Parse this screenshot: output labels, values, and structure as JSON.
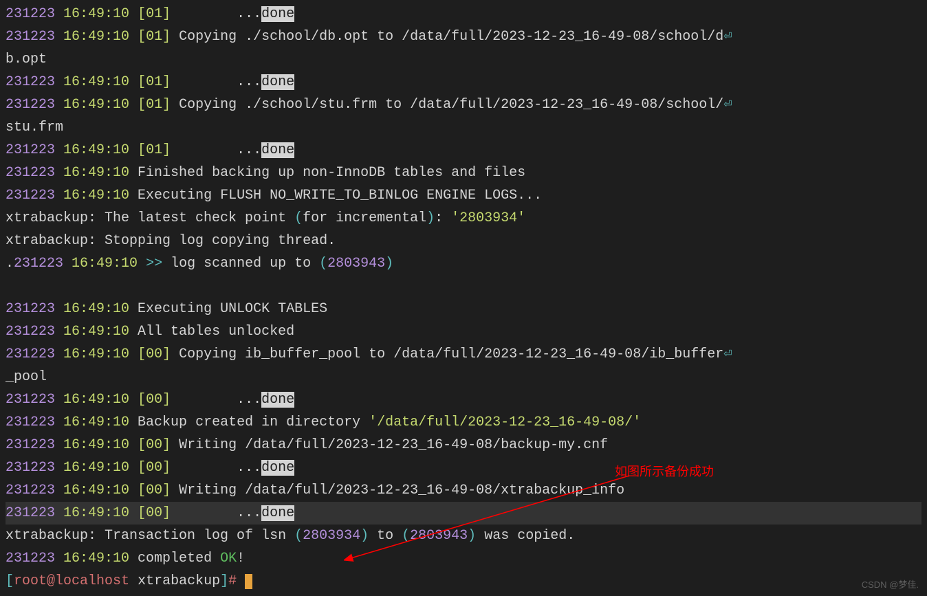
{
  "lines": [
    {
      "segments": [
        {
          "c": "ts-date",
          "t": "231223"
        },
        {
          "c": "txt",
          "t": " "
        },
        {
          "c": "ts-time",
          "t": "16:49:10"
        },
        {
          "c": "txt",
          "t": " "
        },
        {
          "c": "tag",
          "t": "[01]"
        },
        {
          "c": "txt",
          "t": "        ..."
        },
        {
          "c": "hl",
          "t": "done"
        }
      ]
    },
    {
      "segments": [
        {
          "c": "ts-date",
          "t": "231223"
        },
        {
          "c": "txt",
          "t": " "
        },
        {
          "c": "ts-time",
          "t": "16:49:10"
        },
        {
          "c": "txt",
          "t": " "
        },
        {
          "c": "tag",
          "t": "[01]"
        },
        {
          "c": "txt",
          "t": " Copying ./school/db.opt to /data/full/2023-12-23_16-49-08/school/d"
        },
        {
          "c": "wrap-icon",
          "t": "⏎"
        }
      ]
    },
    {
      "segments": [
        {
          "c": "txt",
          "t": "b.opt"
        }
      ]
    },
    {
      "segments": [
        {
          "c": "ts-date",
          "t": "231223"
        },
        {
          "c": "txt",
          "t": " "
        },
        {
          "c": "ts-time",
          "t": "16:49:10"
        },
        {
          "c": "txt",
          "t": " "
        },
        {
          "c": "tag",
          "t": "[01]"
        },
        {
          "c": "txt",
          "t": "        ..."
        },
        {
          "c": "hl",
          "t": "done"
        }
      ]
    },
    {
      "segments": [
        {
          "c": "ts-date",
          "t": "231223"
        },
        {
          "c": "txt",
          "t": " "
        },
        {
          "c": "ts-time",
          "t": "16:49:10"
        },
        {
          "c": "txt",
          "t": " "
        },
        {
          "c": "tag",
          "t": "[01]"
        },
        {
          "c": "txt",
          "t": " Copying ./school/stu.frm to /data/full/2023-12-23_16-49-08/school/"
        },
        {
          "c": "wrap-icon",
          "t": "⏎"
        }
      ]
    },
    {
      "segments": [
        {
          "c": "txt",
          "t": "stu.frm"
        }
      ]
    },
    {
      "segments": [
        {
          "c": "ts-date",
          "t": "231223"
        },
        {
          "c": "txt",
          "t": " "
        },
        {
          "c": "ts-time",
          "t": "16:49:10"
        },
        {
          "c": "txt",
          "t": " "
        },
        {
          "c": "tag",
          "t": "[01]"
        },
        {
          "c": "txt",
          "t": "        ..."
        },
        {
          "c": "hl",
          "t": "done"
        }
      ]
    },
    {
      "segments": [
        {
          "c": "ts-date",
          "t": "231223"
        },
        {
          "c": "txt",
          "t": " "
        },
        {
          "c": "ts-time",
          "t": "16:49:10"
        },
        {
          "c": "txt",
          "t": " Finished backing up non-InnoDB tables and files"
        }
      ]
    },
    {
      "segments": [
        {
          "c": "ts-date",
          "t": "231223"
        },
        {
          "c": "txt",
          "t": " "
        },
        {
          "c": "ts-time",
          "t": "16:49:10"
        },
        {
          "c": "txt",
          "t": " Executing FLUSH NO_WRITE_TO_BINLOG ENGINE LOGS..."
        }
      ]
    },
    {
      "segments": [
        {
          "c": "txt",
          "t": "xtrabackup: The latest check point "
        },
        {
          "c": "cyan",
          "t": "("
        },
        {
          "c": "txt",
          "t": "for incremental"
        },
        {
          "c": "cyan",
          "t": ")"
        },
        {
          "c": "txt",
          "t": ": "
        },
        {
          "c": "yellow",
          "t": "'2803934'"
        }
      ]
    },
    {
      "segments": [
        {
          "c": "txt",
          "t": "xtrabackup: Stopping log copying thread."
        }
      ]
    },
    {
      "segments": [
        {
          "c": "txt",
          "t": "."
        },
        {
          "c": "ts-date",
          "t": "231223"
        },
        {
          "c": "txt",
          "t": " "
        },
        {
          "c": "ts-time",
          "t": "16:49:10"
        },
        {
          "c": "txt",
          "t": " "
        },
        {
          "c": "cyan",
          "t": ">>"
        },
        {
          "c": "txt",
          "t": " log scanned up to "
        },
        {
          "c": "cyan",
          "t": "("
        },
        {
          "c": "ts-date",
          "t": "2803943"
        },
        {
          "c": "cyan",
          "t": ")"
        }
      ]
    },
    {
      "segments": [
        {
          "c": "txt",
          "t": " "
        }
      ]
    },
    {
      "segments": [
        {
          "c": "ts-date",
          "t": "231223"
        },
        {
          "c": "txt",
          "t": " "
        },
        {
          "c": "ts-time",
          "t": "16:49:10"
        },
        {
          "c": "txt",
          "t": " Executing UNLOCK TABLES"
        }
      ]
    },
    {
      "segments": [
        {
          "c": "ts-date",
          "t": "231223"
        },
        {
          "c": "txt",
          "t": " "
        },
        {
          "c": "ts-time",
          "t": "16:49:10"
        },
        {
          "c": "txt",
          "t": " All tables unlocked"
        }
      ]
    },
    {
      "segments": [
        {
          "c": "ts-date",
          "t": "231223"
        },
        {
          "c": "txt",
          "t": " "
        },
        {
          "c": "ts-time",
          "t": "16:49:10"
        },
        {
          "c": "txt",
          "t": " "
        },
        {
          "c": "tag",
          "t": "[00]"
        },
        {
          "c": "txt",
          "t": " Copying ib_buffer_pool to /data/full/2023-12-23_16-49-08/ib_buffer"
        },
        {
          "c": "wrap-icon",
          "t": "⏎"
        }
      ]
    },
    {
      "segments": [
        {
          "c": "txt",
          "t": "_pool"
        }
      ]
    },
    {
      "segments": [
        {
          "c": "ts-date",
          "t": "231223"
        },
        {
          "c": "txt",
          "t": " "
        },
        {
          "c": "ts-time",
          "t": "16:49:10"
        },
        {
          "c": "txt",
          "t": " "
        },
        {
          "c": "tag",
          "t": "[00]"
        },
        {
          "c": "txt",
          "t": "        ..."
        },
        {
          "c": "hl",
          "t": "done"
        }
      ]
    },
    {
      "segments": [
        {
          "c": "ts-date",
          "t": "231223"
        },
        {
          "c": "txt",
          "t": " "
        },
        {
          "c": "ts-time",
          "t": "16:49:10"
        },
        {
          "c": "txt",
          "t": " Backup created in directory "
        },
        {
          "c": "yellow",
          "t": "'/data/full/2023-12-23_16-49-08/'"
        }
      ]
    },
    {
      "segments": [
        {
          "c": "ts-date",
          "t": "231223"
        },
        {
          "c": "txt",
          "t": " "
        },
        {
          "c": "ts-time",
          "t": "16:49:10"
        },
        {
          "c": "txt",
          "t": " "
        },
        {
          "c": "tag",
          "t": "[00]"
        },
        {
          "c": "txt",
          "t": " Writing /data/full/2023-12-23_16-49-08/backup-my.cnf"
        }
      ]
    },
    {
      "segments": [
        {
          "c": "ts-date",
          "t": "231223"
        },
        {
          "c": "txt",
          "t": " "
        },
        {
          "c": "ts-time",
          "t": "16:49:10"
        },
        {
          "c": "txt",
          "t": " "
        },
        {
          "c": "tag",
          "t": "[00]"
        },
        {
          "c": "txt",
          "t": "        ..."
        },
        {
          "c": "hl",
          "t": "done"
        }
      ]
    },
    {
      "segments": [
        {
          "c": "ts-date",
          "t": "231223"
        },
        {
          "c": "txt",
          "t": " "
        },
        {
          "c": "ts-time",
          "t": "16:49:10"
        },
        {
          "c": "txt",
          "t": " "
        },
        {
          "c": "tag",
          "t": "[00]"
        },
        {
          "c": "txt",
          "t": " Writing /data/full/2023-12-23_16-49-08/xtrabackup_info"
        }
      ]
    },
    {
      "cl": true,
      "segments": [
        {
          "c": "ts-date",
          "t": "231223"
        },
        {
          "c": "txt",
          "t": " "
        },
        {
          "c": "ts-time",
          "t": "16:49:10"
        },
        {
          "c": "txt",
          "t": " "
        },
        {
          "c": "tag",
          "t": "[00]"
        },
        {
          "c": "txt",
          "t": "        ..."
        },
        {
          "c": "hl",
          "t": "done"
        }
      ]
    },
    {
      "segments": [
        {
          "c": "txt",
          "t": "xtrabackup: Transaction log of lsn "
        },
        {
          "c": "cyan",
          "t": "("
        },
        {
          "c": "ts-date",
          "t": "2803934"
        },
        {
          "c": "cyan",
          "t": ")"
        },
        {
          "c": "txt",
          "t": " to "
        },
        {
          "c": "cyan",
          "t": "("
        },
        {
          "c": "ts-date",
          "t": "2803943"
        },
        {
          "c": "cyan",
          "t": ")"
        },
        {
          "c": "txt",
          "t": " was copied."
        }
      ]
    },
    {
      "segments": [
        {
          "c": "ts-date",
          "t": "231223"
        },
        {
          "c": "txt",
          "t": " "
        },
        {
          "c": "ts-time",
          "t": "16:49:10"
        },
        {
          "c": "txt",
          "t": " completed "
        },
        {
          "c": "green",
          "t": "OK"
        },
        {
          "c": "txt",
          "t": "!"
        }
      ]
    }
  ],
  "prompt": {
    "open": "[",
    "user": "root",
    "at": "@",
    "host": "localhost",
    "dir": " xtrabackup",
    "close": "]",
    "hash": "#"
  },
  "annotation": "如图所示备份成功",
  "watermark": "CSDN @梦佳."
}
